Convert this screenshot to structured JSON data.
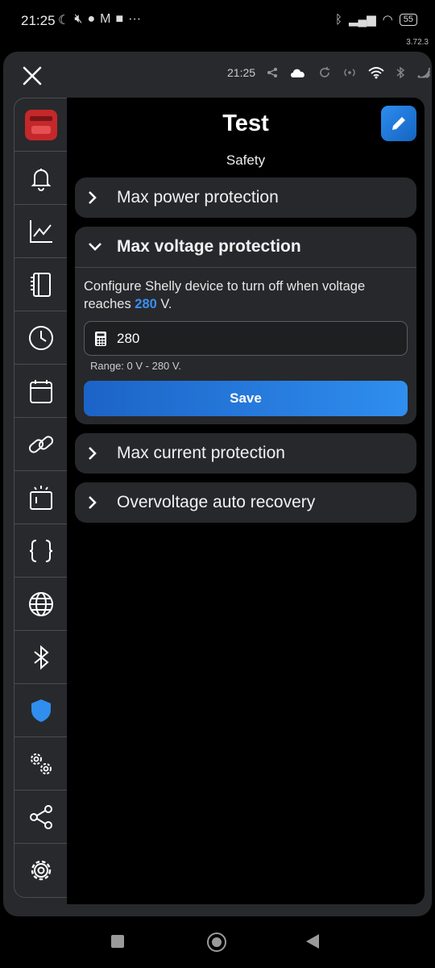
{
  "status_bar": {
    "time": "21:25",
    "left_icons": [
      "moon-icon",
      "mute-icon",
      "chat-icon",
      "gmail-icon",
      "bag-icon",
      "more-icon"
    ],
    "right_icons": [
      "bluetooth-icon",
      "signal-icon",
      "wifi-icon"
    ],
    "battery": "55"
  },
  "app_version": "3.72.3",
  "app_header": {
    "time": "21:25",
    "icons": [
      "share-icon",
      "cloud-icon",
      "sync-icon",
      "broadcast-icon",
      "wifi-icon",
      "bluetooth-icon",
      "rss-icon"
    ]
  },
  "sidebar": {
    "items": [
      {
        "name": "device-thumbnail"
      },
      {
        "name": "bell-icon"
      },
      {
        "name": "chart-icon"
      },
      {
        "name": "device-icon"
      },
      {
        "name": "clock-icon"
      },
      {
        "name": "calendar-icon"
      },
      {
        "name": "link-icon"
      },
      {
        "name": "input-icon"
      },
      {
        "name": "script-braces-icon"
      },
      {
        "name": "globe-icon"
      },
      {
        "name": "bluetooth-icon"
      },
      {
        "name": "shield-icon",
        "active": true
      },
      {
        "name": "gears-icon"
      },
      {
        "name": "share-icon"
      },
      {
        "name": "settings-icon"
      }
    ]
  },
  "page": {
    "title": "Test",
    "subtitle": "Safety"
  },
  "panels": [
    {
      "label": "Max power protection",
      "expanded": false
    },
    {
      "label": "Max voltage protection",
      "expanded": true,
      "description_prefix": "Configure Shelly device to turn off when voltage reaches",
      "description_value": "280",
      "description_suffix": "V.",
      "input_value": "280",
      "range_text": "Range: 0 V - 280 V.",
      "save_label": "Save"
    },
    {
      "label": "Max current protection",
      "expanded": false
    },
    {
      "label": "Overvoltage auto recovery",
      "expanded": false
    }
  ],
  "colors": {
    "accent": "#2f8eee",
    "highlight": "#3a8ff0",
    "panel_bg": "#27282b",
    "window_bg": "#28292c"
  }
}
